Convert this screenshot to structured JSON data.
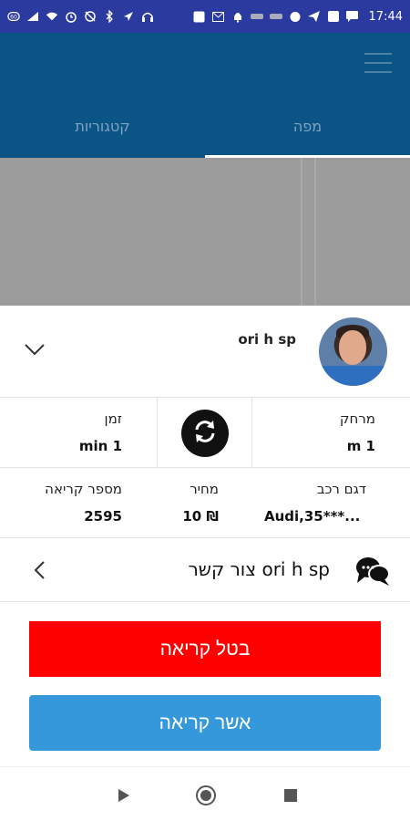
{
  "status_bar": {
    "time": "17:44",
    "left_icons": [
      "data-saver-icon",
      "signal-icon",
      "wifi-icon",
      "alarm-icon",
      "mute-icon",
      "bluetooth-icon",
      "location-icon",
      "headphones-icon"
    ],
    "right_icons": [
      "cast-icon",
      "mail-icon",
      "notification-icon",
      "app-icon",
      "app-icon",
      "shield-icon",
      "telegram-icon",
      "download-icon",
      "chat-icon"
    ]
  },
  "header": {
    "tabs": [
      {
        "label": "קטגוריות",
        "active": false
      },
      {
        "label": "מפה",
        "active": true
      }
    ]
  },
  "driver": {
    "name": "ori h sp"
  },
  "stats": {
    "time_label": "זמן",
    "time_value": "min 1",
    "distance_label": "מרחק",
    "distance_value": "m 1"
  },
  "details": {
    "call_number_label": "מספר קריאה",
    "call_number_value": "2595",
    "price_label": "מחיר",
    "price_value": "10 ₪",
    "car_model_label": "דגם רכב",
    "car_model_value": "Audi,35***..."
  },
  "contact": {
    "label": "צור קשר ori h sp"
  },
  "actions": {
    "cancel_label": "בטל קריאה",
    "approve_label": "אשר קריאה"
  },
  "colors": {
    "status_bar": "#2b3a9e",
    "header": "#0a5586",
    "cancel": "#fe0000",
    "approve": "#3598db"
  }
}
